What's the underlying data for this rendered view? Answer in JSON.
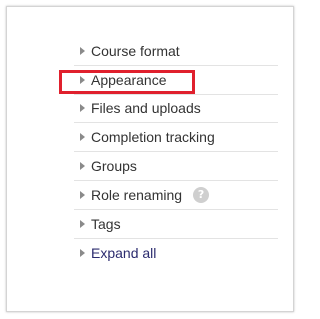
{
  "sections": {
    "items": [
      {
        "label": "Course format"
      },
      {
        "label": "Appearance"
      },
      {
        "label": "Files and uploads"
      },
      {
        "label": "Completion tracking"
      },
      {
        "label": "Groups"
      },
      {
        "label": "Role renaming",
        "help": "?"
      },
      {
        "label": "Tags"
      }
    ],
    "expand_all": "Expand all",
    "highlighted_item": "Appearance",
    "highlight_color": "#e0202d"
  }
}
